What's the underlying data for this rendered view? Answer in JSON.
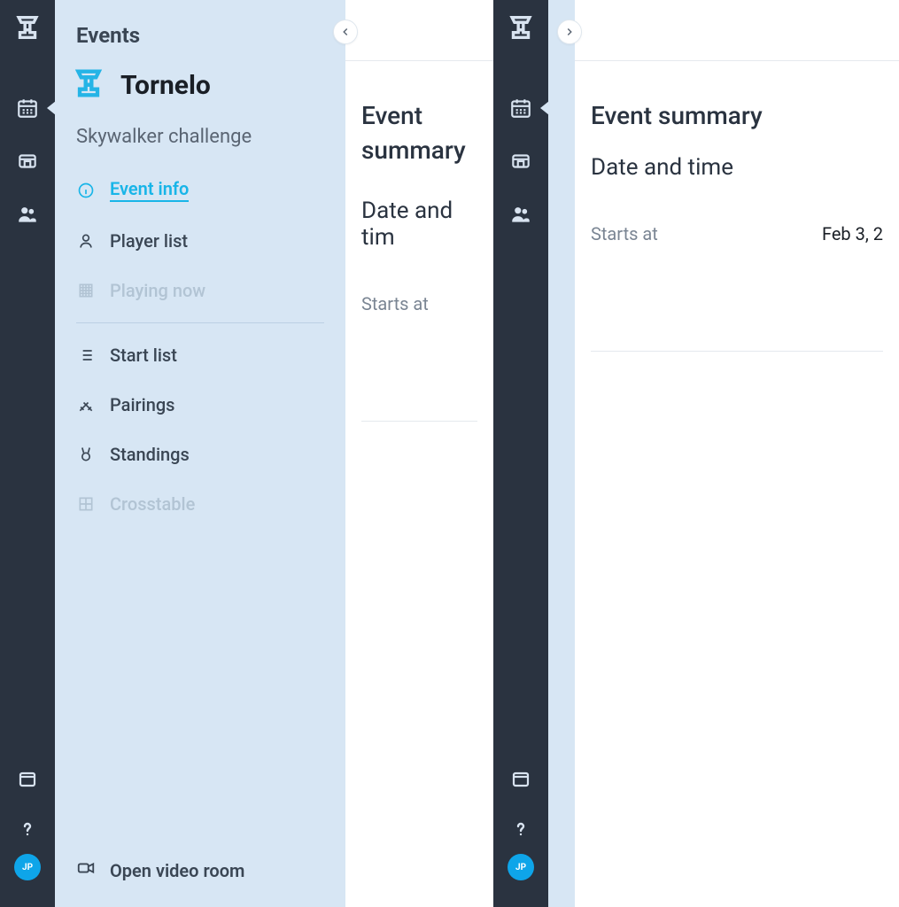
{
  "left": {
    "sidebar_title": "Events",
    "org_name": "Tornelo",
    "event_name": "Skywalker challenge",
    "nav": {
      "event_info": "Event info",
      "player_list": "Player list",
      "playing_now": "Playing now",
      "start_list": "Start list",
      "pairings": "Pairings",
      "standings": "Standings",
      "crosstable": "Crosstable"
    },
    "open_video": "Open video room",
    "content_title": "Event summary",
    "section_title": "Date and tim",
    "starts_at_label": "Starts at",
    "avatar_initials": "JP"
  },
  "right": {
    "content_title": "Event summary",
    "section_title": "Date and time",
    "starts_at_label": "Starts at",
    "starts_at_value": "Feb 3, 2",
    "avatar_initials": "JP"
  }
}
